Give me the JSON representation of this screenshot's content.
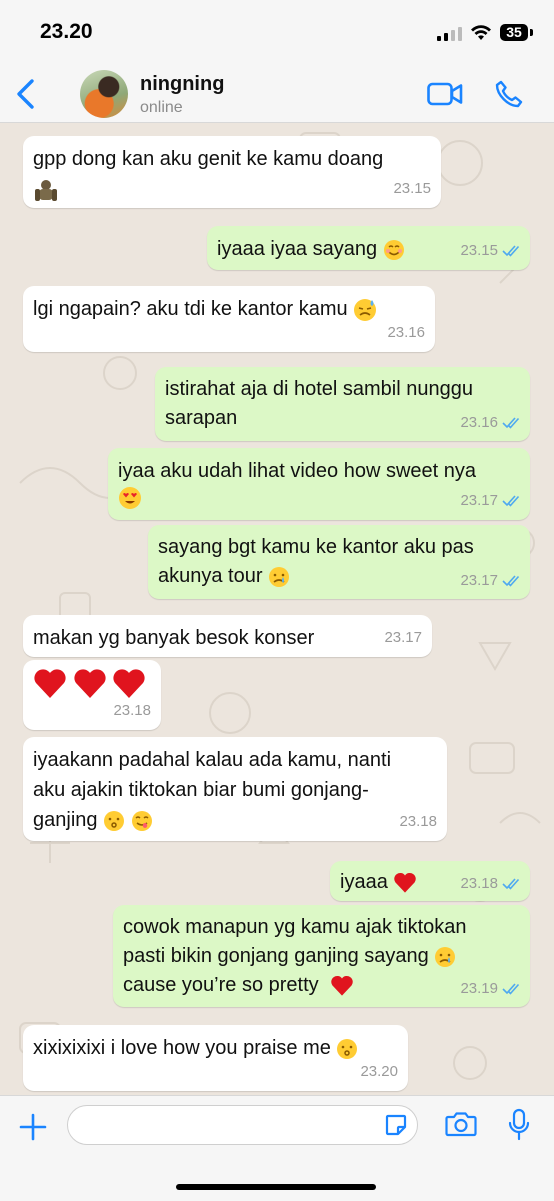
{
  "status_bar": {
    "time": "23.20",
    "battery": "35"
  },
  "header": {
    "contact_name": "ningning",
    "contact_status": "online"
  },
  "messages": [
    {
      "dir": "in",
      "text": "gpp dong kan aku genit ke kamu doang",
      "time": "23.15"
    },
    {
      "dir": "out",
      "text": "iyaaa iyaa sayang",
      "time": "23.15"
    },
    {
      "dir": "in",
      "text": "lgi ngapain? aku tdi ke kantor kamu",
      "time": "23.16"
    },
    {
      "dir": "out",
      "line1": "istirahat aja di hotel sambil nunggu",
      "line2": "sarapan",
      "time": "23.16"
    },
    {
      "dir": "out",
      "text": "iyaa aku udah lihat video how sweet nya",
      "time": "23.17"
    },
    {
      "dir": "out",
      "line1": "sayang bgt kamu ke kantor aku pas",
      "line2": "akunya tour",
      "time": "23.17"
    },
    {
      "dir": "in",
      "text": "makan yg banyak besok konser",
      "time": "23.17"
    },
    {
      "dir": "in",
      "text": "",
      "time": "23.18"
    },
    {
      "dir": "in",
      "line1": "iyaakann padahal kalau ada kamu, nanti",
      "line2": "aku ajakin tiktokan biar bumi gonjang-",
      "line3": "ganjing",
      "time": "23.18"
    },
    {
      "dir": "out",
      "text": "iyaaa",
      "time": "23.18"
    },
    {
      "dir": "out",
      "line1": "cowok manapun yg kamu ajak tiktokan",
      "line2": "pasti bikin gonjang ganjing sayang",
      "line3": "cause you’re so pretty",
      "time": "23.19"
    },
    {
      "dir": "in",
      "text": "xixixixixi i love how you praise me",
      "time": "23.20"
    }
  ],
  "emojis": [
    "smiling-face-emoji",
    "sad-sweat-emoji",
    "heart-eyes-emoji",
    "crying-face-emoji",
    "red-heart-emoji",
    "kissing-face-emoji",
    "yum-face-emoji",
    "gorilla-sticker"
  ],
  "colors": {
    "accent": "#1a84ff",
    "outgoing_bubble": "#dcf8c6",
    "incoming_bubble": "#ffffff",
    "chat_bg": "#ece5dd",
    "read_ticks": "#4fa9f0"
  }
}
